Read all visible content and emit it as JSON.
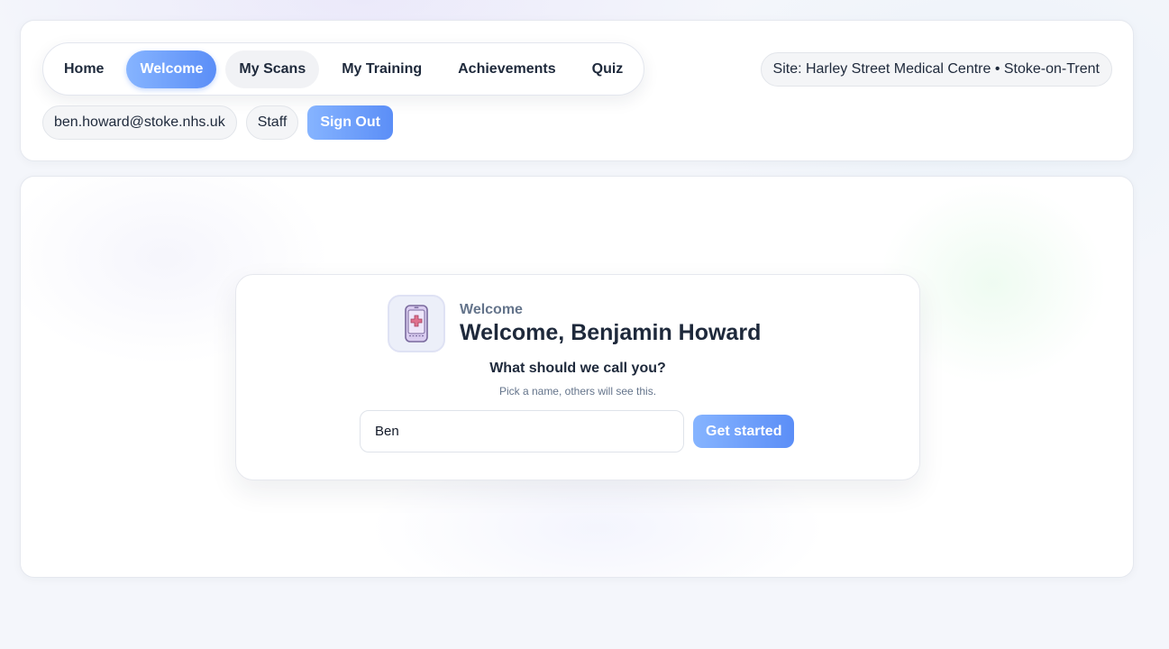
{
  "nav": {
    "items": [
      {
        "label": "Home"
      },
      {
        "label": "Welcome",
        "active": true
      },
      {
        "label": "My Scans"
      },
      {
        "label": "My Training"
      },
      {
        "label": "Achievements"
      },
      {
        "label": "Quiz"
      }
    ]
  },
  "site": {
    "label": "Site: Harley Street Medical Centre • Stoke-on-Trent"
  },
  "user": {
    "email": "ben.howard@stoke.nhs.uk",
    "role": "Staff",
    "sign_out_label": "Sign Out"
  },
  "welcome": {
    "icon": "phone-medical-icon",
    "eyebrow": "Welcome",
    "title": "Welcome, Benjamin Howard",
    "question": "What should we call you?",
    "hint": "Pick a name, others will see this.",
    "name_value": "Ben",
    "submit_label": "Get started"
  },
  "colors": {
    "accent_start": "#86b4ff",
    "accent_end": "#5b8ef7",
    "text_dark": "#1e293b",
    "text_muted": "#64748b"
  }
}
